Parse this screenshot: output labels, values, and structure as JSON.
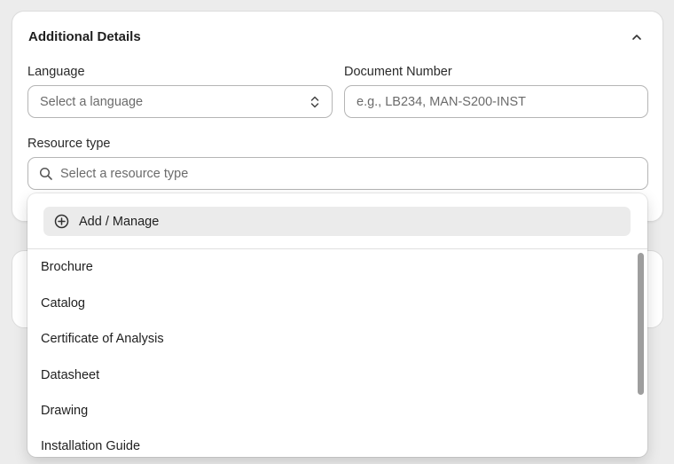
{
  "section": {
    "title": "Additional Details"
  },
  "language": {
    "label": "Language",
    "placeholder": "Select a language"
  },
  "document_number": {
    "label": "Document Number",
    "placeholder": "e.g., LB234, MAN-S200-INST"
  },
  "resource_type": {
    "label": "Resource type",
    "placeholder": "Select a resource type"
  },
  "dropdown": {
    "add_manage_label": "Add / Manage",
    "options": [
      "Brochure",
      "Catalog",
      "Certificate of Analysis",
      "Datasheet",
      "Drawing",
      "Installation Guide"
    ]
  },
  "icons": {
    "collapse": "chevron-up-icon",
    "select": "select-arrows-icon",
    "search": "search-icon",
    "add": "plus-circle-icon"
  }
}
